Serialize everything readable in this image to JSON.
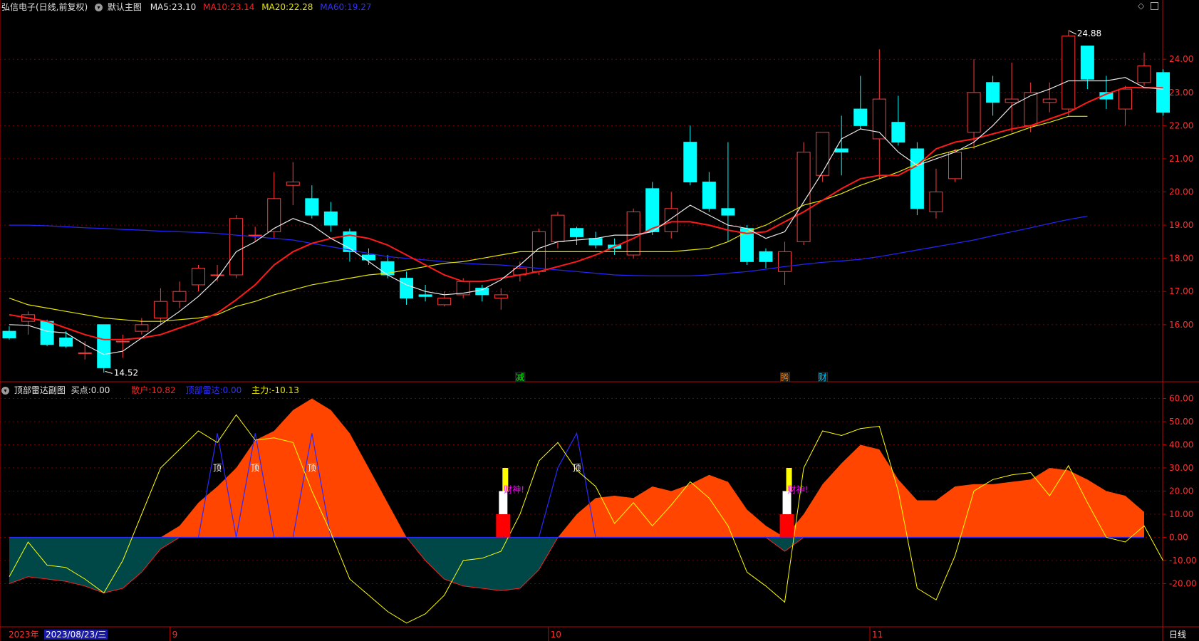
{
  "main_header": {
    "title": "弘信电子(日线,前复权)",
    "main_chart_label": "默认主图",
    "ma5_label": "MA5:",
    "ma5_value": "23.10",
    "ma10_label": "MA10:",
    "ma10_value": "23.14",
    "ma20_label": "MA20:",
    "ma20_value": "22.28",
    "ma60_label": "MA60:",
    "ma60_value": "19.27"
  },
  "sub_header": {
    "title": "顶部雷达副图",
    "buy_label": "买点:",
    "buy_value": "0.00",
    "retail_label": "散户:",
    "retail_value": "10.82",
    "radar_label": "顶部雷达:",
    "radar_value": "0.00",
    "main_force_label": "主力:",
    "main_force_value": "-10.13"
  },
  "colors": {
    "up": "#ff3a3a",
    "down": "#00ffff",
    "ma5": "#e8e8e8",
    "ma10": "#ff1a1a",
    "ma20": "#e6e600",
    "ma60": "#2626ff",
    "retail_area": "#ff4500",
    "negative_area": "#004848",
    "axis": "#c00000",
    "axis_text": "#ff3030"
  },
  "price_axis": {
    "labels": [
      "24.00",
      "23.00",
      "22.00",
      "21.00",
      "20.00",
      "19.00",
      "18.00",
      "17.00",
      "16.00"
    ],
    "ylim": [
      14.3,
      25.4
    ]
  },
  "indicator_axis": {
    "labels": [
      "60.00",
      "50.00",
      "40.00",
      "30.00",
      "20.00",
      "10.00",
      "0.00",
      "-10.00",
      "-20.00"
    ],
    "ylim": [
      -38,
      62
    ]
  },
  "price_annotations": {
    "high": "24.88",
    "low": "14.52"
  },
  "event_markers": [
    {
      "label": "减",
      "index": 27,
      "color": "#00ff00"
    },
    {
      "label": "腾",
      "index": 41,
      "color": "#ff8000"
    },
    {
      "label": "财",
      "index": 43,
      "color": "#00c8ff"
    }
  ],
  "signal_labels": {
    "top_marks": [
      {
        "label": "顶",
        "index": 11
      },
      {
        "label": "顶",
        "index": 13
      },
      {
        "label": "顶",
        "index": 16
      },
      {
        "label": "顶",
        "index": 30
      }
    ],
    "caishen": [
      {
        "label": "财神!",
        "index": 26
      },
      {
        "label": "财神!",
        "index": 41
      }
    ]
  },
  "time_axis": {
    "year": "2023年",
    "date_cursor": "2023/08/23/三",
    "months": [
      {
        "label": "9",
        "index": 9
      },
      {
        "label": "10",
        "index": 29
      },
      {
        "label": "11",
        "index": 46
      }
    ],
    "period": "日线"
  },
  "chart_data": [
    {
      "type": "candlestick",
      "title": "弘信电子(日线,前复权)",
      "series_names": [
        "MA5",
        "MA10",
        "MA20",
        "MA60"
      ],
      "candles": [
        [
          15.8,
          15.6,
          15.95,
          15.55
        ],
        [
          16.1,
          16.3,
          16.4,
          15.7
        ],
        [
          16.1,
          15.4,
          16.15,
          15.35
        ],
        [
          15.6,
          15.35,
          15.8,
          15.3
        ],
        [
          15.15,
          15.15,
          15.5,
          14.95
        ],
        [
          16.0,
          14.7,
          16.0,
          14.55
        ],
        [
          15.5,
          15.5,
          15.7,
          15.0
        ],
        [
          15.8,
          16.0,
          16.2,
          15.7
        ],
        [
          16.2,
          16.7,
          17.1,
          16.0
        ],
        [
          16.7,
          17.0,
          17.3,
          16.5
        ],
        [
          17.2,
          17.7,
          17.8,
          17.0
        ],
        [
          17.5,
          17.5,
          17.8,
          17.3
        ],
        [
          17.5,
          19.2,
          19.3,
          17.4
        ],
        [
          18.7,
          18.7,
          18.95,
          18.5
        ],
        [
          18.8,
          19.8,
          20.6,
          18.6
        ],
        [
          20.2,
          20.3,
          20.9,
          19.6
        ],
        [
          19.8,
          19.3,
          20.2,
          19.2
        ],
        [
          19.4,
          19.0,
          19.7,
          18.8
        ],
        [
          18.8,
          18.2,
          18.9,
          17.9
        ],
        [
          18.1,
          17.95,
          18.3,
          17.8
        ],
        [
          17.9,
          17.5,
          18.1,
          17.4
        ],
        [
          17.4,
          16.8,
          17.6,
          16.6
        ],
        [
          16.9,
          16.85,
          17.2,
          16.7
        ],
        [
          16.6,
          16.8,
          17.0,
          16.55
        ],
        [
          16.9,
          17.3,
          17.4,
          16.8
        ],
        [
          17.1,
          16.9,
          17.2,
          16.7
        ],
        [
          16.8,
          16.9,
          17.1,
          16.45
        ],
        [
          17.5,
          17.7,
          17.9,
          17.3
        ],
        [
          17.6,
          18.8,
          18.9,
          17.5
        ],
        [
          18.5,
          19.3,
          19.4,
          18.3
        ],
        [
          18.9,
          18.65,
          18.95,
          18.4
        ],
        [
          18.6,
          18.4,
          18.8,
          18.3
        ],
        [
          18.4,
          18.3,
          18.6,
          18.1
        ],
        [
          18.1,
          19.4,
          19.5,
          18.0
        ],
        [
          20.1,
          18.8,
          20.3,
          18.7
        ],
        [
          18.8,
          19.5,
          20.0,
          18.6
        ],
        [
          21.5,
          20.3,
          22.0,
          20.2
        ],
        [
          20.3,
          19.5,
          20.6,
          19.4
        ],
        [
          19.5,
          19.3,
          21.5,
          18.5
        ],
        [
          18.9,
          17.9,
          19.0,
          17.8
        ],
        [
          18.2,
          17.9,
          18.3,
          17.7
        ],
        [
          17.6,
          18.2,
          18.5,
          17.2
        ],
        [
          18.5,
          21.2,
          21.5,
          18.4
        ],
        [
          20.5,
          21.8,
          21.8,
          20.3
        ],
        [
          21.3,
          21.2,
          22.3,
          20.5
        ],
        [
          22.5,
          22.0,
          23.5,
          21.9
        ],
        [
          21.6,
          22.8,
          24.3,
          20.4
        ],
        [
          22.1,
          21.5,
          22.9,
          21.4
        ],
        [
          21.3,
          19.5,
          21.5,
          19.3
        ],
        [
          19.4,
          20.0,
          20.7,
          19.2
        ],
        [
          20.4,
          21.2,
          21.3,
          20.3
        ],
        [
          21.8,
          23.0,
          24.0,
          21.3
        ],
        [
          23.3,
          22.7,
          23.5,
          22.3
        ],
        [
          22.7,
          22.8,
          23.9,
          21.8
        ],
        [
          22.0,
          23.0,
          23.3,
          21.8
        ],
        [
          22.7,
          22.8,
          23.3,
          22.4
        ],
        [
          22.5,
          24.7,
          24.88,
          22.3
        ],
        [
          24.4,
          23.4,
          24.4,
          23.1
        ],
        [
          23.0,
          22.8,
          23.5,
          22.5
        ],
        [
          22.5,
          23.1,
          23.2,
          22.0
        ],
        [
          23.3,
          23.8,
          24.2,
          23.2
        ],
        [
          23.6,
          22.4,
          23.7,
          22.3
        ]
      ],
      "ma5": [
        16.0,
        15.98,
        15.8,
        15.75,
        15.4,
        15.1,
        15.2,
        15.6,
        16.0,
        16.4,
        16.85,
        17.4,
        18.2,
        18.5,
        18.9,
        19.2,
        19.0,
        18.6,
        18.3,
        17.9,
        17.5,
        17.2,
        17.0,
        16.9,
        16.95,
        17.05,
        17.35,
        17.8,
        18.3,
        18.5,
        18.55,
        18.6,
        18.7,
        18.7,
        18.8,
        19.2,
        19.6,
        19.3,
        19.0,
        18.9,
        18.6,
        18.8,
        19.7,
        20.6,
        21.6,
        21.9,
        21.8,
        21.2,
        20.8,
        21.0,
        21.2,
        21.5,
        22.0,
        22.6,
        22.9,
        23.1,
        23.35,
        23.35,
        23.35,
        23.45,
        23.15,
        23.1
      ],
      "ma10": [
        16.3,
        16.2,
        16.1,
        15.9,
        15.7,
        15.55,
        15.55,
        15.6,
        15.7,
        15.9,
        16.1,
        16.35,
        16.75,
        17.2,
        17.8,
        18.2,
        18.45,
        18.6,
        18.7,
        18.6,
        18.4,
        18.1,
        17.8,
        17.5,
        17.3,
        17.3,
        17.4,
        17.5,
        17.6,
        17.75,
        17.9,
        18.1,
        18.35,
        18.6,
        18.9,
        19.1,
        19.1,
        19.0,
        18.85,
        18.75,
        18.8,
        19.1,
        19.4,
        19.75,
        20.1,
        20.4,
        20.5,
        20.5,
        20.8,
        21.3,
        21.5,
        21.6,
        21.75,
        21.9,
        22.0,
        22.2,
        22.4,
        22.7,
        22.95,
        23.15,
        23.14,
        23.14
      ],
      "ma20": [
        16.8,
        16.6,
        16.5,
        16.4,
        16.3,
        16.2,
        16.15,
        16.1,
        16.1,
        16.15,
        16.2,
        16.3,
        16.55,
        16.7,
        16.9,
        17.05,
        17.2,
        17.3,
        17.4,
        17.5,
        17.55,
        17.65,
        17.75,
        17.85,
        17.9,
        18.0,
        18.1,
        18.2,
        18.2,
        18.2,
        18.2,
        18.2,
        18.2,
        18.2,
        18.2,
        18.2,
        18.25,
        18.3,
        18.5,
        18.8,
        19.0,
        19.3,
        19.6,
        19.75,
        19.95,
        20.2,
        20.4,
        20.6,
        20.85,
        21.1,
        21.25,
        21.35,
        21.55,
        21.75,
        21.95,
        22.1,
        22.28,
        22.28
      ],
      "ma60": [
        19.0,
        19.0,
        18.98,
        18.95,
        18.92,
        18.9,
        18.87,
        18.85,
        18.82,
        18.8,
        18.78,
        18.75,
        18.7,
        18.65,
        18.6,
        18.55,
        18.45,
        18.35,
        18.25,
        18.15,
        18.05,
        18.0,
        17.95,
        17.9,
        17.85,
        17.82,
        17.8,
        17.75,
        17.7,
        17.65,
        17.6,
        17.55,
        17.5,
        17.48,
        17.47,
        17.47,
        17.47,
        17.5,
        17.55,
        17.6,
        17.67,
        17.75,
        17.82,
        17.88,
        17.92,
        17.97,
        18.05,
        18.15,
        18.25,
        18.35,
        18.45,
        18.55,
        18.68,
        18.8,
        18.92,
        19.05,
        19.17,
        19.27
      ]
    },
    {
      "type": "area",
      "title": "顶部雷达副图",
      "series_names": [
        "散户",
        "顶部雷达",
        "主力"
      ],
      "retail": [
        -20,
        -17,
        -18,
        -19,
        -21,
        -24,
        -22,
        -15,
        -5,
        5,
        15,
        22,
        30,
        42,
        46,
        55,
        60,
        55,
        45,
        30,
        15,
        0,
        -10,
        -18,
        -21,
        -22,
        -23,
        -22,
        -14,
        0,
        10,
        17,
        18,
        17,
        22,
        20,
        23,
        27,
        24,
        12,
        5,
        -6,
        10,
        23,
        32,
        40,
        38,
        25,
        16,
        16,
        22,
        23,
        23,
        24,
        25,
        30,
        29,
        25,
        20,
        18,
        11
      ],
      "radar": [
        0,
        0,
        0,
        0,
        0,
        0,
        0,
        0,
        0,
        0,
        0,
        45,
        0,
        45,
        0,
        0,
        45,
        0,
        0,
        0,
        0,
        0,
        0,
        0,
        0,
        0,
        0,
        0,
        0,
        30,
        45,
        0,
        0,
        0,
        0,
        0,
        0,
        0,
        0,
        0,
        0,
        0,
        0,
        0,
        0,
        0,
        0,
        0,
        0,
        0,
        0,
        0,
        0,
        0,
        0,
        0,
        0,
        0,
        0,
        0,
        0
      ],
      "main_force": [
        -17,
        -2,
        -12,
        -13,
        -18,
        -24,
        -10,
        10,
        30,
        38,
        46,
        41,
        53,
        42,
        43,
        41,
        20,
        2,
        -18,
        -25,
        -32,
        -37,
        -33,
        -25,
        -10,
        -9,
        -6,
        10,
        33,
        41,
        29,
        22,
        6,
        15,
        5,
        14,
        24,
        17,
        5,
        -15,
        -21,
        -28,
        30,
        46,
        44,
        47,
        48,
        20,
        -22,
        -27,
        -8,
        20,
        25,
        27,
        28,
        18,
        31,
        15,
        0,
        -2,
        5,
        -10
      ]
    }
  ]
}
